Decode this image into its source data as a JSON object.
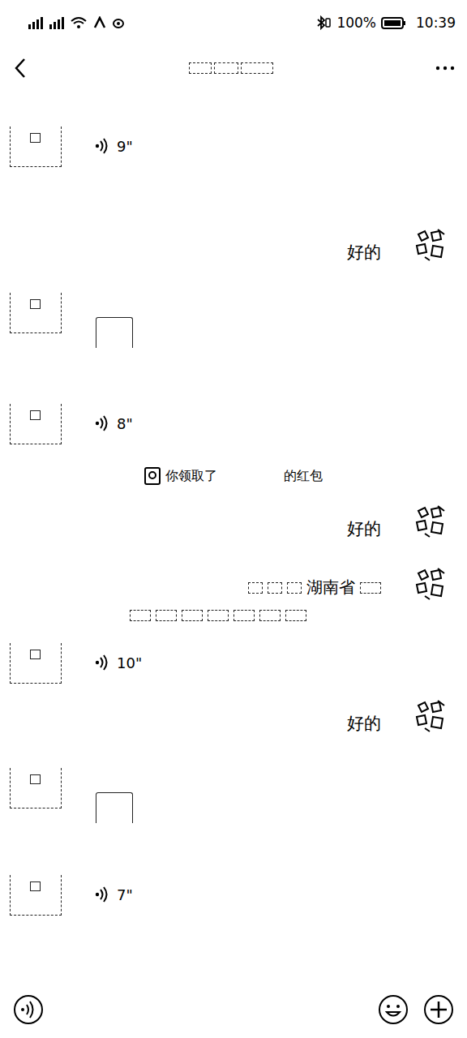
{
  "status_bar": {
    "battery": "100%",
    "time": "10:39"
  },
  "messages": [
    {
      "kind": "voice",
      "side": "left",
      "duration": "9\""
    },
    {
      "kind": "text",
      "side": "right",
      "text": "好的"
    },
    {
      "kind": "image",
      "side": "left"
    },
    {
      "kind": "voice",
      "side": "left",
      "duration": "8\""
    },
    {
      "kind": "system",
      "side": "center",
      "before": "你领取了",
      "after": "的红包"
    },
    {
      "kind": "text",
      "side": "right",
      "text": "好的"
    },
    {
      "kind": "address",
      "side": "right",
      "text": "湖南省"
    },
    {
      "kind": "voice",
      "side": "left",
      "duration": "10\""
    },
    {
      "kind": "text",
      "side": "right",
      "text": "好的"
    },
    {
      "kind": "image",
      "side": "left"
    },
    {
      "kind": "voice",
      "side": "left",
      "duration": "7\""
    }
  ]
}
